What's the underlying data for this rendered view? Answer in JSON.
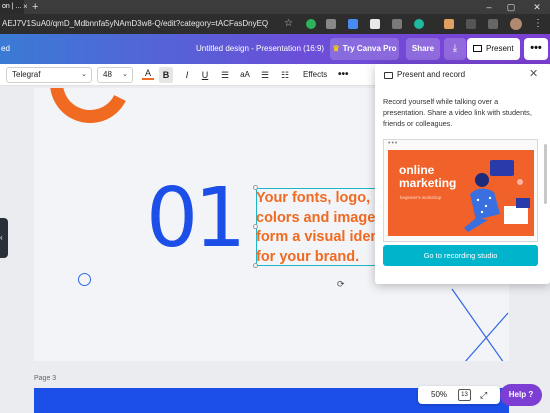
{
  "browser": {
    "tab_title": "on | ...",
    "url": "AEJ7V1SuA0/qmD_Mdbnnfa5yNAmD3w8-Q/edit?category=tACFasDnyEQ"
  },
  "header": {
    "left_fragment": "ed",
    "document_title": "Untitled design - Presentation (16:9)",
    "try_pro_label": "Try Canva Pro",
    "share_label": "Share",
    "present_label": "Present"
  },
  "toolbar": {
    "font_name": "Telegraf",
    "font_size": "48",
    "text_color_label": "A",
    "bold_label": "B",
    "italic_label": "I",
    "underline_label": "U",
    "case_label": "aA",
    "effects_label": "Effects",
    "more_label": "•••"
  },
  "slide": {
    "number": "01",
    "text_lines": [
      "Your fonts, logo,",
      "colors and images",
      "form a visual identity",
      "for your brand."
    ]
  },
  "page3_label": "Page 3",
  "zoom": {
    "value": "50%",
    "page_count": "13"
  },
  "help_label": "Help ?",
  "popover": {
    "title": "Present and record",
    "description": "Record yourself while talking over a presentation. Share a video link with students, friends or colleagues.",
    "preview_title": "online marketing",
    "preview_subtitle": "beginner's workshop",
    "button_label": "Go to recording studio"
  },
  "colors": {
    "brand_purple": "#7d3fd3",
    "brand_blue": "#3a7bd5",
    "slide_orange": "#f06a22",
    "slide_blue": "#1b4fe8",
    "teal_button": "#00b4cc"
  }
}
